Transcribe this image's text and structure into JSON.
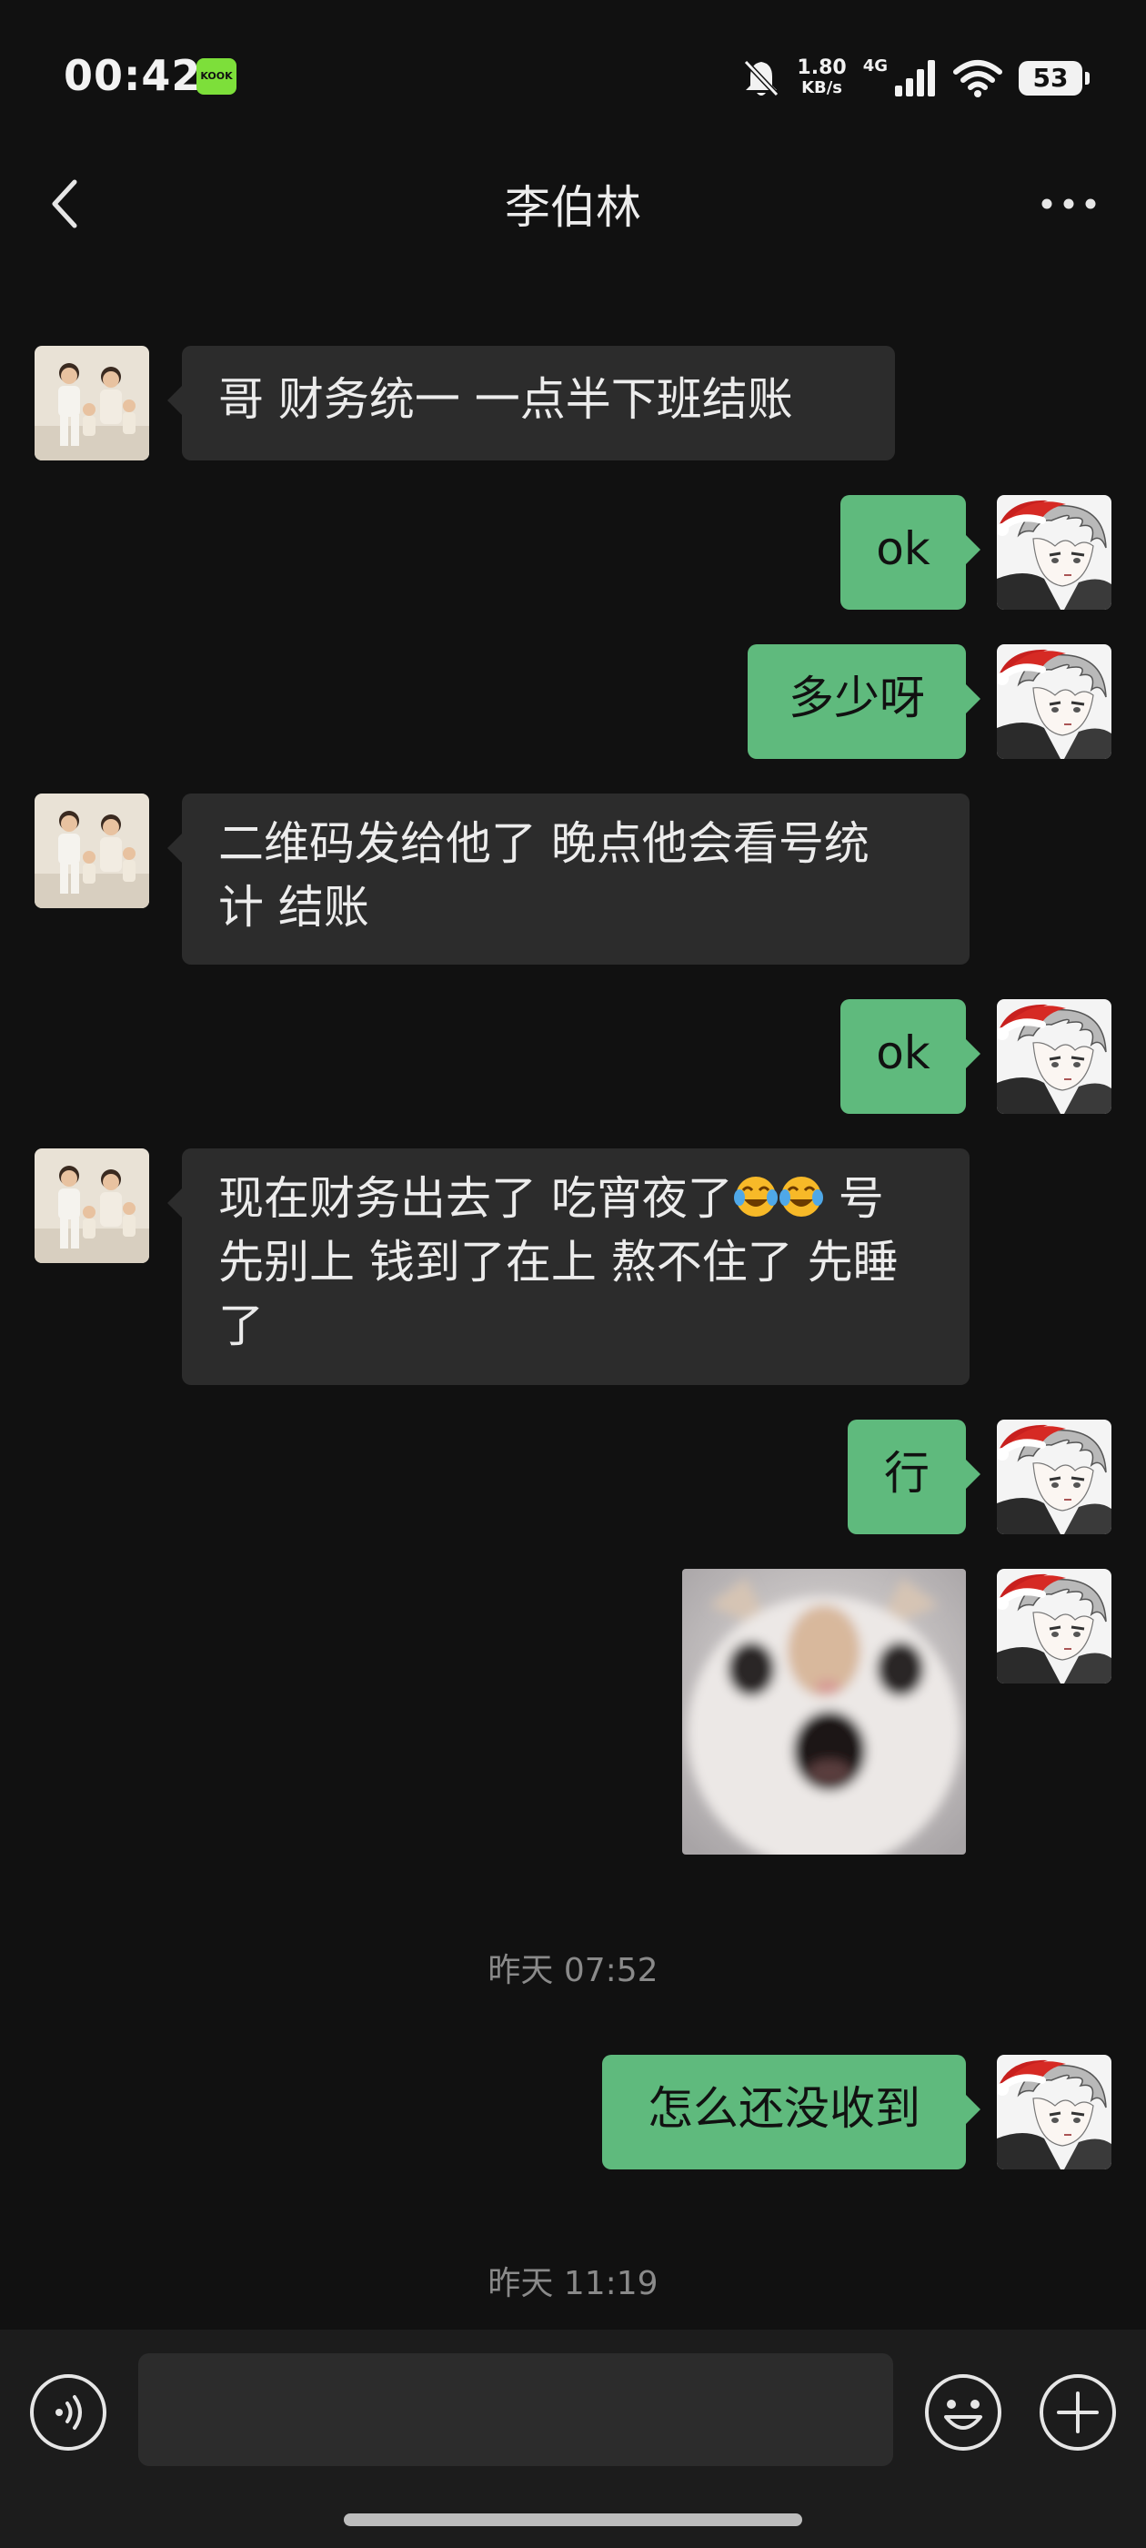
{
  "status_bar": {
    "time": "00:42",
    "app_badge": "KOOK",
    "net_speed_value": "1.80",
    "net_speed_unit": "KB/s",
    "signal_label": "4G",
    "battery": "53"
  },
  "header": {
    "title": "李伯林"
  },
  "messages": [
    {
      "side": "in",
      "text": "哥 财务统一 一点半下班结账"
    },
    {
      "side": "out",
      "text": "ok"
    },
    {
      "side": "out",
      "text": "多少呀"
    },
    {
      "side": "in",
      "line1": "二维码发给他了 晚点他会看号统",
      "line2": "计 结账"
    },
    {
      "side": "out",
      "text": "ok"
    },
    {
      "side": "in",
      "line1_pre": "现在财务出去了 吃宵夜了",
      "emoji": "laughing-crying-emoji",
      "line1_post": " 号",
      "line2": "先别上 钱到了在上 熬不住了 先睡",
      "line3": "了"
    },
    {
      "side": "out",
      "text": "行"
    },
    {
      "side": "out",
      "type": "sticker",
      "sticker": "surprised-cat-sticker"
    },
    {
      "side": "out",
      "text": "怎么还没收到"
    }
  ],
  "timestamps": [
    "昨天 07:52",
    "昨天 11:19"
  ],
  "input": {
    "value": "",
    "placeholder": ""
  },
  "icons": {
    "back": "chevron-left-icon",
    "more": "more-dots-icon",
    "voice": "voice-icon",
    "emoji": "emoji-icon",
    "plus": "plus-icon"
  },
  "colors": {
    "background": "#111111",
    "bubble_in": "#2c2c2c",
    "bubble_out": "#5fba7d",
    "input_bar": "#1c1c1c"
  }
}
